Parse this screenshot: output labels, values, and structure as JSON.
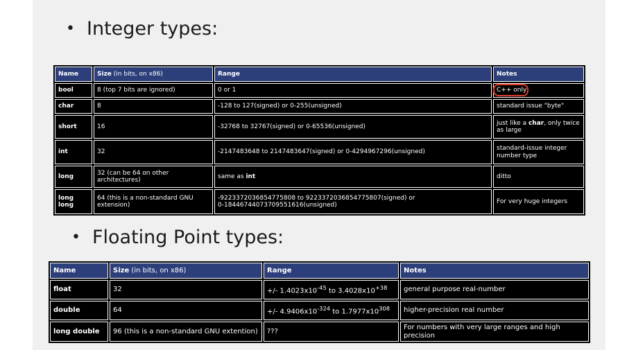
{
  "integer_section": {
    "bullet": "•",
    "heading": "Integer types:",
    "headers": {
      "name": "Name",
      "size_label": "Size",
      "size_sub": " (in bits, on x86)",
      "range": "Range",
      "notes": "Notes"
    },
    "rows": [
      {
        "name": "bool",
        "size": "8 (top 7 bits are ignored)",
        "range": "0 or 1",
        "notes": "C++ only"
      },
      {
        "name": "char",
        "size": "8",
        "range": "-128 to 127(signed) or 0-255(unsigned)",
        "notes": "standard issue \"byte\""
      },
      {
        "name": "short",
        "size": "16",
        "range": "-32768 to 32767(signed) or 0-65536(unsigned)",
        "notes_pre": "just like a ",
        "notes_kw": "char",
        "notes_post": ", only twice as large"
      },
      {
        "name": "int",
        "size": "32",
        "range": "-2147483648 to 2147483647(signed) or 0-4294967296(unsigned)",
        "notes": "standard-issue integer number type"
      },
      {
        "name": "long",
        "size": "32 (can be 64 on other architectures)",
        "range_pre": "same as ",
        "range_kw": "int",
        "notes": "ditto"
      },
      {
        "name": "long long",
        "size": "64 (this is a non-standard GNU extension)",
        "range_line1": "-9223372036854775808 to 9223372036854775807(signed) or",
        "range_line2": "0-18446744073709551616(unsigned)",
        "notes": "For very huge integers"
      }
    ]
  },
  "float_section": {
    "bullet": "•",
    "heading": "Floating Point types:",
    "headers": {
      "name": "Name",
      "size_label": "Size",
      "size_sub": " (in bits, on x86)",
      "range": "Range",
      "notes": "Notes"
    },
    "rows": [
      {
        "name": "float",
        "size": "32",
        "range_a": "+/- 1.4023x10",
        "range_a_exp": "-45",
        "range_mid": " to 3.4028x10",
        "range_b_exp": "+38",
        "notes": "general purpose real-number"
      },
      {
        "name": "double",
        "size": "64",
        "range_a": "+/- 4.9406x10",
        "range_a_exp": "-324",
        "range_mid": " to 1.7977x10",
        "range_b_exp": "308",
        "notes": "higher-precision real number"
      },
      {
        "name": "long double",
        "size": "96 (this is a non-standard GNU extention)",
        "range": "???",
        "notes": "For numbers with very large ranges and high precision"
      }
    ]
  },
  "colors": {
    "header_bg": "#2c3f7a",
    "table_bg": "#000000",
    "slide_bg": "#f0f0f0",
    "highlight_circle": "#e23a2a"
  }
}
